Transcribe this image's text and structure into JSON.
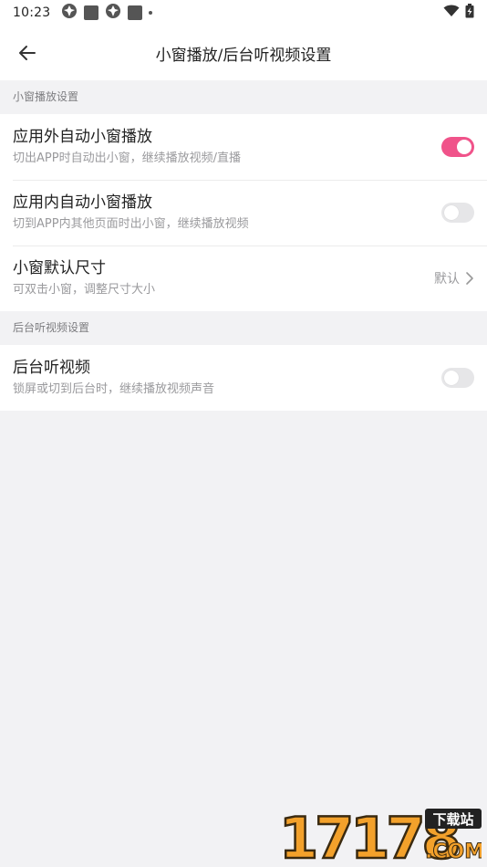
{
  "status_bar": {
    "time": "10:23",
    "icons": [
      "gear-notification-icon",
      "app-notification-icon",
      "gear-notification-icon",
      "app-notification-icon",
      "dot-icon"
    ],
    "right_icons": [
      "wifi-icon",
      "battery-charging-icon"
    ]
  },
  "app_bar": {
    "back_icon": "arrow-left-icon",
    "title": "小窗播放/后台听视频设置"
  },
  "sections": [
    {
      "header": "小窗播放设置",
      "items": [
        {
          "title": "应用外自动小窗播放",
          "subtitle": "切出APP时自动出小窗，继续播放视频/直播",
          "toggle": true
        },
        {
          "title": "应用内自动小窗播放",
          "subtitle": "切到APP内其他页面时出小窗，继续播放视频",
          "toggle": false
        },
        {
          "title": "小窗默认尺寸",
          "subtitle": "可双击小窗，调整尺寸大小",
          "value": "默认"
        }
      ]
    },
    {
      "header": "后台听视频设置",
      "items": [
        {
          "title": "后台听视频",
          "subtitle": "锁屏或切到后台时，继续播放视频声音",
          "toggle": false
        }
      ]
    }
  ],
  "colors": {
    "accent": "#f0538a",
    "background": "#f2f2f4",
    "toggle_off": "#e6e6e8"
  },
  "watermark": {
    "text": "17178",
    "badge": "下载站",
    "domain": ".COM"
  }
}
